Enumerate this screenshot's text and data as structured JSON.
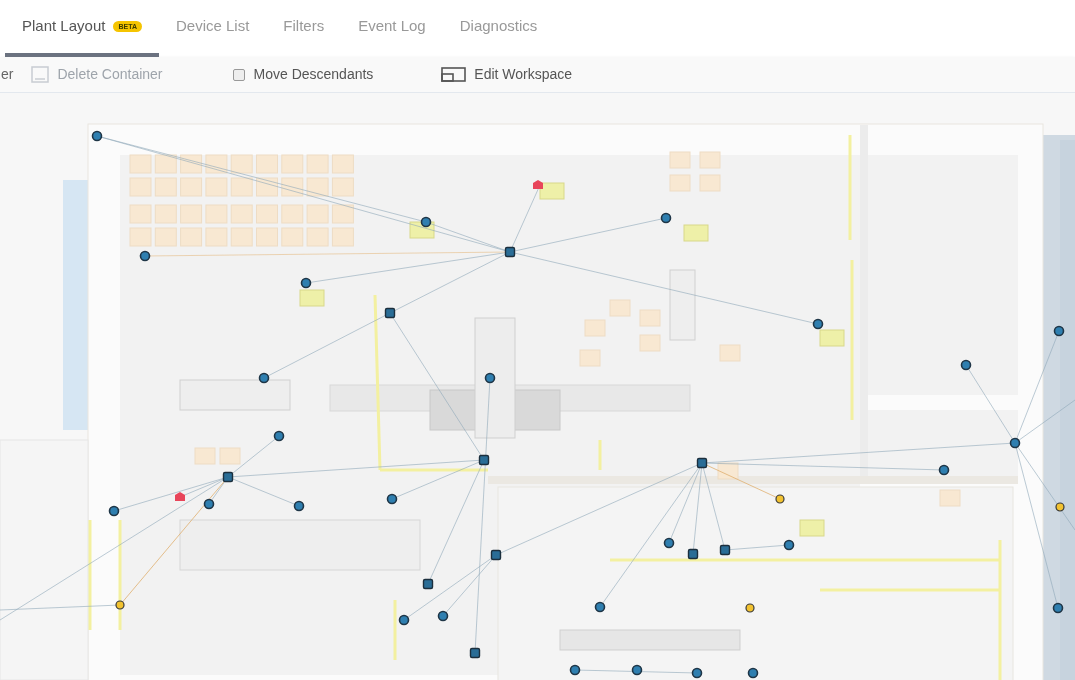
{
  "tabs": [
    {
      "label": "Plant Layout",
      "badge": "BETA",
      "selected": true
    },
    {
      "label": "Device List",
      "selected": false
    },
    {
      "label": "Filters",
      "selected": false
    },
    {
      "label": "Event Log",
      "selected": false
    },
    {
      "label": "Diagnostics",
      "selected": false
    }
  ],
  "toolbar": [
    {
      "kind": "cut",
      "label": "er"
    },
    {
      "kind": "container",
      "label": "Delete Container",
      "disabled": true
    },
    {
      "kind": "checkbox",
      "label": "Move Descendants",
      "checked": false
    },
    {
      "kind": "workspace",
      "label": "Edit Workspace",
      "disabled": false
    }
  ]
}
